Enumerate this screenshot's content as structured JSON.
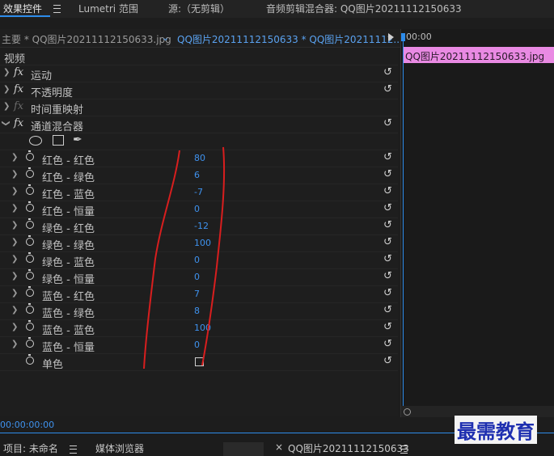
{
  "tabs": [
    {
      "label": "效果控件",
      "active": true
    },
    {
      "label": "Lumetri 范围",
      "active": false
    },
    {
      "label": "源:（无剪辑）",
      "active": false
    },
    {
      "label": "音频剪辑混合器: QQ图片20211112150633",
      "active": false
    }
  ],
  "sequence_bar": {
    "master": "主要 * QQ图片20211112150633.jpg",
    "clip": "QQ图片20211112150633  * QQ图片20211112..."
  },
  "effects": {
    "section_label": "视频",
    "items": [
      {
        "label": "运动"
      },
      {
        "label": "不透明度"
      },
      {
        "label": "时间重映射"
      },
      {
        "label": "通道混合器"
      }
    ],
    "params": [
      {
        "label": "红色 - 红色",
        "value": "80"
      },
      {
        "label": "红色 - 绿色",
        "value": "6"
      },
      {
        "label": "红色 - 蓝色",
        "value": "-7"
      },
      {
        "label": "红色 - 恒量",
        "value": "0"
      },
      {
        "label": "绿色 - 红色",
        "value": "-12"
      },
      {
        "label": "绿色 - 绿色",
        "value": "100"
      },
      {
        "label": "绿色 - 蓝色",
        "value": "0"
      },
      {
        "label": "绿色 - 恒量",
        "value": "0"
      },
      {
        "label": "蓝色 - 红色",
        "value": "7"
      },
      {
        "label": "蓝色 - 绿色",
        "value": "8"
      },
      {
        "label": "蓝色 - 蓝色",
        "value": "100"
      },
      {
        "label": "蓝色 - 恒量",
        "value": "0"
      }
    ],
    "mono_label": "单色"
  },
  "timeline": {
    "time": "00:00",
    "clip_name": "QQ图片20211112150633.jpg",
    "clip_color": "#e98ae3"
  },
  "timecode": "00:00:00:00",
  "bottom": {
    "project": "项目: 未命名",
    "media_browser": "媒体浏览器",
    "sequence_tab": "QQ图片20211112150633"
  },
  "watermark": "最需教育",
  "colors": {
    "accent": "#2d8ceb",
    "value_blue": "#3f92ee"
  }
}
